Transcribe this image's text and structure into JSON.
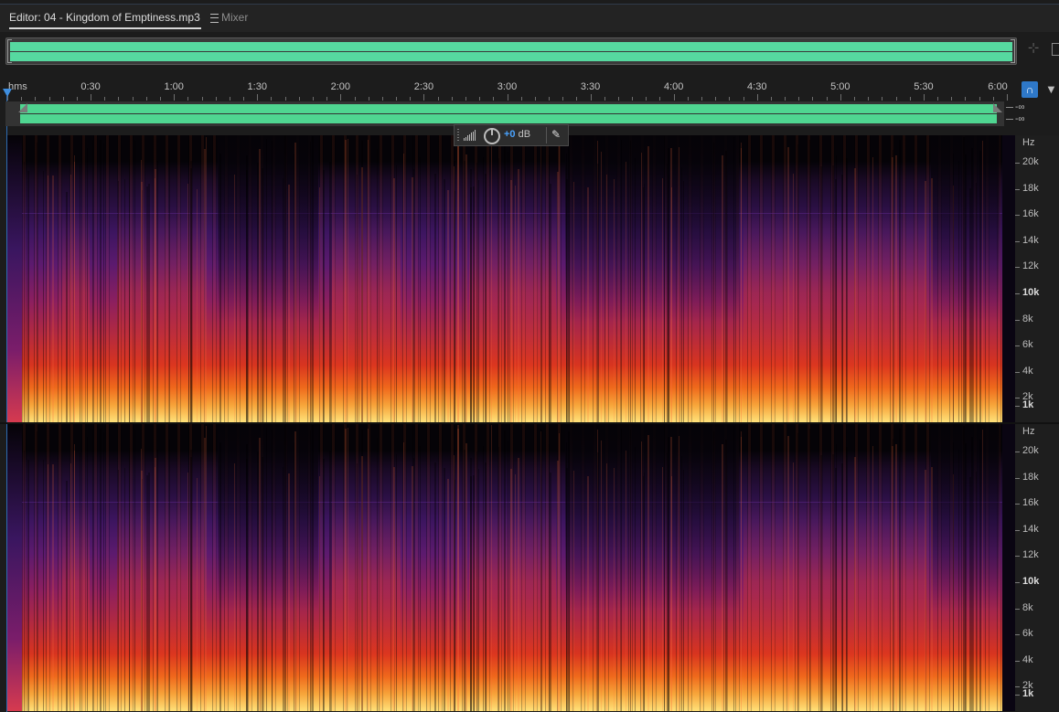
{
  "tabs": {
    "editor_label": "Editor: 04 - Kingdom of Emptiness.mp3",
    "mixer_label": "Mixer"
  },
  "ruler": {
    "units_label": "hms",
    "labels": [
      "0:30",
      "1:00",
      "1:30",
      "2:00",
      "2:30",
      "3:00",
      "3:30",
      "4:00",
      "4:30",
      "5:00",
      "5:30",
      "6:00"
    ]
  },
  "track": {
    "volume_top": "-∞",
    "volume_bottom": "-∞"
  },
  "hud": {
    "gain_value": "+0",
    "gain_unit": "dB"
  },
  "frequency_axis": {
    "unit": "Hz",
    "labels": [
      "20k",
      "18k",
      "16k",
      "14k",
      "12k",
      "10k",
      "8k",
      "6k",
      "4k",
      "2k",
      "1k"
    ]
  },
  "colors": {
    "waveform": "#56d9a0",
    "accent": "#2e78c8",
    "playhead": "#3f8fe0"
  },
  "icons": {
    "zoom": "zoom-to-selection-icon",
    "monitor": "headphones-icon",
    "marker": "marker-pin-icon",
    "pin": "pin-icon",
    "menu": "hamburger-menu-icon"
  }
}
